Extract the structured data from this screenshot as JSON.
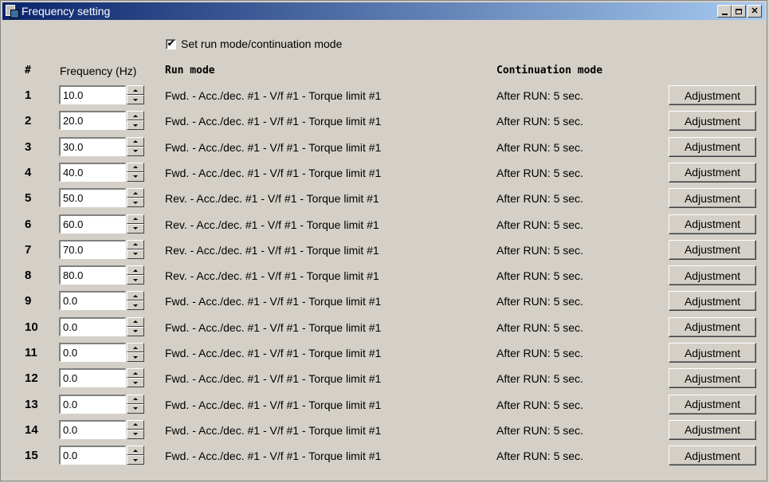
{
  "window": {
    "title": "Frequency setting"
  },
  "checkbox": {
    "label": "Set run mode/continuation mode",
    "checked": true,
    "mark": "✔"
  },
  "headers": {
    "num": "#",
    "frequency": "Frequency (Hz)",
    "run_mode": "Run mode",
    "continuation_mode": "Continuation mode"
  },
  "rows": [
    {
      "num": "1",
      "frequency": "10.0",
      "run_mode": "Fwd. - Acc./dec. #1 - V/f #1 - Torque limit #1",
      "continuation_mode": "After RUN: 5 sec.",
      "button": "Adjustment"
    },
    {
      "num": "2",
      "frequency": "20.0",
      "run_mode": "Fwd. - Acc./dec. #1 - V/f #1 - Torque limit #1",
      "continuation_mode": "After RUN: 5 sec.",
      "button": "Adjustment"
    },
    {
      "num": "3",
      "frequency": "30.0",
      "run_mode": "Fwd. - Acc./dec. #1 - V/f #1 - Torque limit #1",
      "continuation_mode": "After RUN: 5 sec.",
      "button": "Adjustment"
    },
    {
      "num": "4",
      "frequency": "40.0",
      "run_mode": "Fwd. - Acc./dec. #1 - V/f #1 - Torque limit #1",
      "continuation_mode": "After RUN: 5 sec.",
      "button": "Adjustment"
    },
    {
      "num": "5",
      "frequency": "50.0",
      "run_mode": "Rev. - Acc./dec. #1 - V/f #1 - Torque limit #1",
      "continuation_mode": "After RUN: 5 sec.",
      "button": "Adjustment"
    },
    {
      "num": "6",
      "frequency": "60.0",
      "run_mode": "Rev. - Acc./dec. #1 - V/f #1 - Torque limit #1",
      "continuation_mode": "After RUN: 5 sec.",
      "button": "Adjustment"
    },
    {
      "num": "7",
      "frequency": "70.0",
      "run_mode": "Rev. - Acc./dec. #1 - V/f #1 - Torque limit #1",
      "continuation_mode": "After RUN: 5 sec.",
      "button": "Adjustment"
    },
    {
      "num": "8",
      "frequency": "80.0",
      "run_mode": "Rev. - Acc./dec. #1 - V/f #1 - Torque limit #1",
      "continuation_mode": "After RUN: 5 sec.",
      "button": "Adjustment"
    },
    {
      "num": "9",
      "frequency": "0.0",
      "run_mode": "Fwd. - Acc./dec. #1 - V/f #1 - Torque limit #1",
      "continuation_mode": "After RUN: 5 sec.",
      "button": "Adjustment"
    },
    {
      "num": "10",
      "frequency": "0.0",
      "run_mode": "Fwd. - Acc./dec. #1 - V/f #1 - Torque limit #1",
      "continuation_mode": "After RUN: 5 sec.",
      "button": "Adjustment"
    },
    {
      "num": "11",
      "frequency": "0.0",
      "run_mode": "Fwd. - Acc./dec. #1 - V/f #1 - Torque limit #1",
      "continuation_mode": "After RUN: 5 sec.",
      "button": "Adjustment"
    },
    {
      "num": "12",
      "frequency": "0.0",
      "run_mode": "Fwd. - Acc./dec. #1 - V/f #1 - Torque limit #1",
      "continuation_mode": "After RUN: 5 sec.",
      "button": "Adjustment"
    },
    {
      "num": "13",
      "frequency": "0.0",
      "run_mode": "Fwd. - Acc./dec. #1 - V/f #1 - Torque limit #1",
      "continuation_mode": "After RUN: 5 sec.",
      "button": "Adjustment"
    },
    {
      "num": "14",
      "frequency": "0.0",
      "run_mode": "Fwd. - Acc./dec. #1 - V/f #1 - Torque limit #1",
      "continuation_mode": "After RUN: 5 sec.",
      "button": "Adjustment"
    },
    {
      "num": "15",
      "frequency": "0.0",
      "run_mode": "Fwd. - Acc./dec. #1 - V/f #1 - Torque limit #1",
      "continuation_mode": "After RUN: 5 sec.",
      "button": "Adjustment"
    }
  ]
}
